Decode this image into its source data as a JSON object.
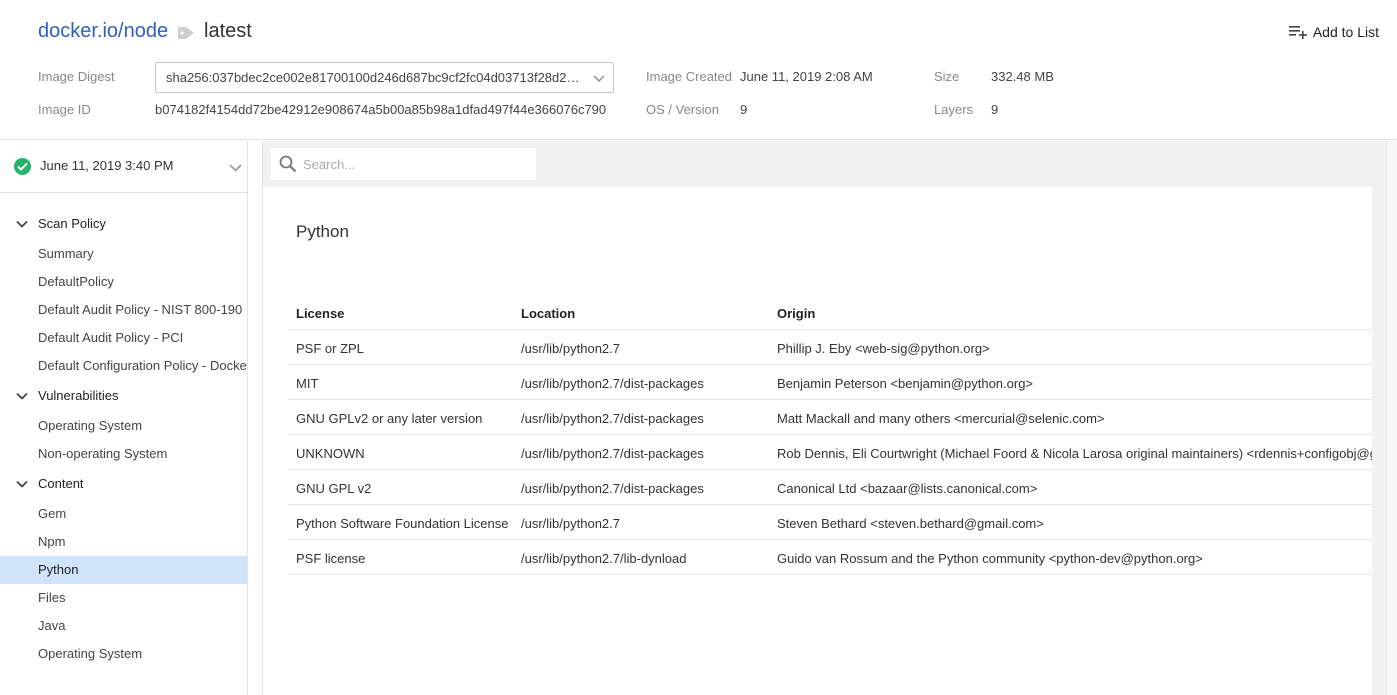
{
  "header": {
    "repository": "docker.io/node",
    "tag": "latest",
    "add_to_list_label": "Add to List",
    "digest_label": "Image Digest",
    "digest_value": "sha256:037bdec2ce002e81700100d246d687bc9cf2fc04d03713f28d2a...",
    "image_id_label": "Image ID",
    "image_id_value": "b074182f4154dd72be42912e908674a5b00a85b98a1dfad497f44e366076c790",
    "created_label": "Image Created",
    "created_value": "June 11, 2019 2:08 AM",
    "os_label": "OS / Version",
    "os_value": "9",
    "size_label": "Size",
    "size_value": "332.48 MB",
    "layers_label": "Layers",
    "layers_value": "9"
  },
  "scan": {
    "date": "June 11, 2019 3:40 PM",
    "status_color": "#25b36b"
  },
  "sidebar": {
    "sections": [
      {
        "label": "Scan Policy",
        "items": [
          "Summary",
          "DefaultPolicy",
          "Default Audit Policy - NIST 800-190",
          "Default Audit Policy - PCI",
          "Default Configuration Policy - Docker"
        ]
      },
      {
        "label": "Vulnerabilities",
        "items": [
          "Operating System",
          "Non-operating System"
        ]
      },
      {
        "label": "Content",
        "items": [
          "Gem",
          "Npm",
          "Python",
          "Files",
          "Java",
          "Operating System"
        ]
      }
    ],
    "active_item": "Python",
    "active_color": "#cfe3fa"
  },
  "search": {
    "placeholder": "Search..."
  },
  "content": {
    "title": "Python",
    "columns": [
      "License",
      "Location",
      "Origin"
    ],
    "rows": [
      [
        "PSF or ZPL",
        "/usr/lib/python2.7",
        "Phillip J. Eby <web-sig@python.org>"
      ],
      [
        "MIT",
        "/usr/lib/python2.7/dist-packages",
        "Benjamin Peterson <benjamin@python.org>"
      ],
      [
        "GNU GPLv2 or any later version",
        "/usr/lib/python2.7/dist-packages",
        "Matt Mackall and many others <mercurial@selenic.com>"
      ],
      [
        "UNKNOWN",
        "/usr/lib/python2.7/dist-packages",
        "Rob Dennis, Eli Courtwright (Michael Foord & Nicola Larosa original maintainers) <rdennis+configobj@gm"
      ],
      [
        "GNU GPL v2",
        "/usr/lib/python2.7/dist-packages",
        "Canonical Ltd <bazaar@lists.canonical.com>"
      ],
      [
        "Python Software Foundation License",
        "/usr/lib/python2.7",
        "Steven Bethard <steven.bethard@gmail.com>"
      ],
      [
        "PSF license",
        "/usr/lib/python2.7/lib-dynload",
        "Guido van Rossum and the Python community <python-dev@python.org>"
      ]
    ]
  }
}
